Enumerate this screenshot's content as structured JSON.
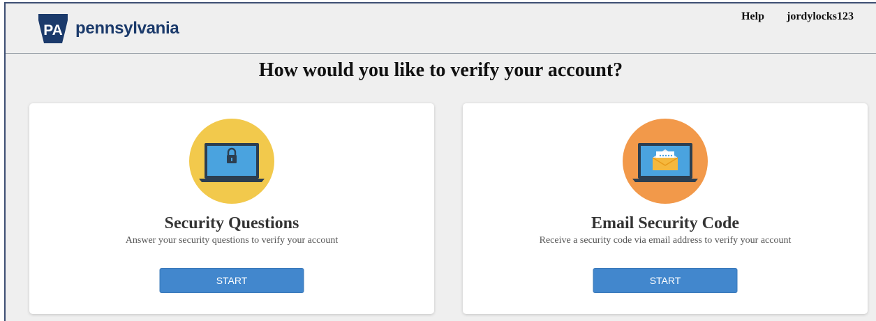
{
  "header": {
    "logo_badge": "PA",
    "logo_text": "pennsylvania",
    "nav": {
      "help": "Help",
      "username": "jordylocks123"
    }
  },
  "main": {
    "title": "How would you like to verify your account?",
    "options": [
      {
        "title": "Security Questions",
        "description": "Answer your security questions to verify your account",
        "button": "START",
        "icon": "laptop-lock-icon",
        "icon_bg": "#f2c94c"
      },
      {
        "title": "Email Security Code",
        "description": "Receive a security code via email address to verify your account",
        "button": "START",
        "icon": "laptop-email-icon",
        "icon_bg": "#f2994a"
      }
    ]
  },
  "colors": {
    "brand": "#1b3a6b",
    "button": "#4287cd",
    "background": "#efefef"
  }
}
